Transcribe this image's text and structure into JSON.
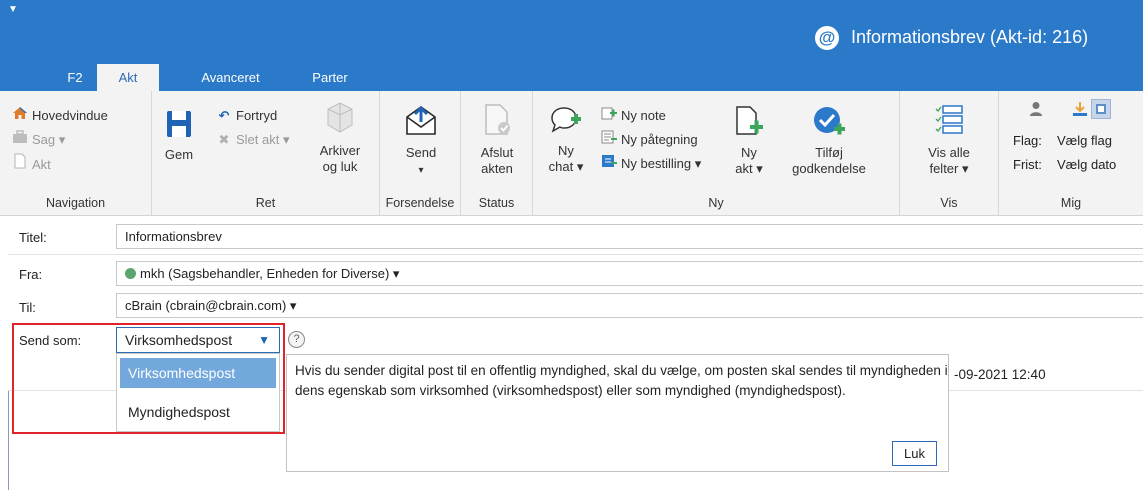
{
  "window": {
    "title": "Informationsbrev (Akt-id: 216)",
    "app_icon": "at-sign-icon"
  },
  "tabs": [
    {
      "label": "F2"
    },
    {
      "label": "Akt"
    },
    {
      "label": "Avanceret"
    },
    {
      "label": "Parter"
    }
  ],
  "ribbon": {
    "navigation": {
      "label": "Navigation",
      "hovedvindue": "Hovedvindue",
      "sag": "Sag ▾",
      "akt": "Akt"
    },
    "ret": {
      "label": "Ret",
      "gem": "Gem",
      "fortryd": "Fortryd",
      "slet_akt": "Slet akt ▾",
      "arkiver_line1": "Arkiver",
      "arkiver_line2": "og luk"
    },
    "forsendelse": {
      "label": "Forsendelse",
      "send": "Send",
      "send_arrow": "▾"
    },
    "status": {
      "label": "Status",
      "afslut_line1": "Afslut",
      "afslut_line2": "akten"
    },
    "ny": {
      "label": "Ny",
      "ny_chat_line1": "Ny",
      "ny_chat_line2": "chat ▾",
      "ny_note": "Ny note",
      "ny_paategning": "Ny påtegning",
      "ny_bestilling": "Ny bestilling ▾",
      "ny_akt_line1": "Ny",
      "ny_akt_line2": "akt ▾",
      "tilfoej_line1": "Tilføj",
      "tilfoej_line2": "godkendelse"
    },
    "vis": {
      "label": "Vis",
      "vis_alle_line1": "Vis alle",
      "vis_alle_line2": "felter ▾"
    },
    "mig": {
      "label": "Mig",
      "flag_label": "Flag:",
      "flag_value": "Vælg flag",
      "frist_label": "Frist:",
      "frist_value": "Vælg dato"
    }
  },
  "form": {
    "titel_label": "Titel:",
    "titel_value": "Informationsbrev",
    "fra_label": "Fra:",
    "fra_value": "mkh (Sagsbehandler, Enheden for Diverse) ▾",
    "til_label": "Til:",
    "til_value": "cBrain (cbrain@cbrain.com) ▾",
    "send_som_label": "Send som:",
    "send_som_value": "Virksomhedspost",
    "send_som_options": [
      "Virksomhedspost",
      "Myndighedspost"
    ],
    "date_partial": "-09-2021 12:40"
  },
  "tooltip": {
    "text": "Hvis du sender digital post til en offentlig myndighed, skal du vælge, om posten skal sendes til myndigheden i dens egenskab som virksomhed (virksomhedspost) eller som myndighed (myndighedspost).",
    "close_label": "Luk"
  },
  "colors": {
    "titlebar": "#2b79c9",
    "ribbon_bg": "#f3f3f3",
    "highlight_box": "#e0242b",
    "selected_option": "#73a8dc"
  }
}
